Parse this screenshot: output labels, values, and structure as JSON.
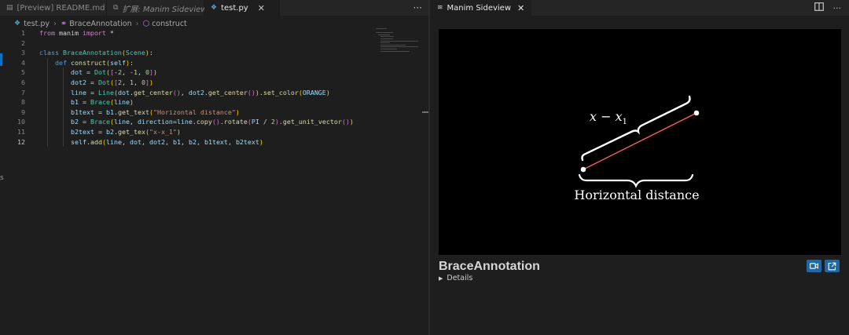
{
  "left_tabs": [
    {
      "icon": "preview-icon",
      "label": "[Preview] README.md",
      "active": false,
      "italic": false
    },
    {
      "icon": "extension-icon",
      "label": "扩展: Manim Sideview",
      "active": false,
      "italic": true
    },
    {
      "icon": "python-file-icon",
      "label": "test.py",
      "active": true,
      "italic": false
    }
  ],
  "tab_actions_glyph": "···",
  "breadcrumb": {
    "file": "test.py",
    "symbol1": "BraceAnnotation",
    "symbol2": "construct"
  },
  "code_lines": [
    {
      "n": "1",
      "indent": 0,
      "tokens": [
        [
          "kw",
          "from"
        ],
        [
          "p",
          " manim "
        ],
        [
          "kw",
          "import"
        ],
        [
          "p",
          " *"
        ]
      ]
    },
    {
      "n": "2",
      "indent": 0,
      "tokens": []
    },
    {
      "n": "3",
      "indent": 0,
      "tokens": [
        [
          "kb",
          "class"
        ],
        [
          "p",
          " "
        ],
        [
          "cls",
          "BraceAnnotation"
        ],
        [
          "brk1",
          "("
        ],
        [
          "cls",
          "Scene"
        ],
        [
          "brk1",
          ")"
        ],
        [
          "p",
          ":"
        ]
      ]
    },
    {
      "n": "4",
      "indent": 1,
      "tokens": [
        [
          "kb",
          "def"
        ],
        [
          "p",
          " "
        ],
        [
          "fn",
          "construct"
        ],
        [
          "brk1",
          "("
        ],
        [
          "var",
          "self"
        ],
        [
          "brk1",
          ")"
        ],
        [
          "p",
          ":"
        ]
      ]
    },
    {
      "n": "5",
      "indent": 2,
      "tokens": [
        [
          "var",
          "dot"
        ],
        [
          "p",
          " = "
        ],
        [
          "cls",
          "Dot"
        ],
        [
          "brk1",
          "("
        ],
        [
          "brk2",
          "["
        ],
        [
          "p",
          "-"
        ],
        [
          "num",
          "2"
        ],
        [
          "p",
          ", -"
        ],
        [
          "num",
          "1"
        ],
        [
          "p",
          ", "
        ],
        [
          "num",
          "0"
        ],
        [
          "brk2",
          "]"
        ],
        [
          "brk1",
          ")"
        ]
      ]
    },
    {
      "n": "6",
      "indent": 2,
      "tokens": [
        [
          "var",
          "dot2"
        ],
        [
          "p",
          " = "
        ],
        [
          "cls",
          "Dot"
        ],
        [
          "brk1",
          "("
        ],
        [
          "brk2",
          "["
        ],
        [
          "num",
          "2"
        ],
        [
          "p",
          ", "
        ],
        [
          "num",
          "1"
        ],
        [
          "p",
          ", "
        ],
        [
          "num",
          "0"
        ],
        [
          "brk2",
          "]"
        ],
        [
          "brk1",
          ")"
        ]
      ]
    },
    {
      "n": "7",
      "indent": 2,
      "tokens": [
        [
          "var",
          "line"
        ],
        [
          "p",
          " = "
        ],
        [
          "cls",
          "Line"
        ],
        [
          "brk1",
          "("
        ],
        [
          "var",
          "dot"
        ],
        [
          "p",
          "."
        ],
        [
          "fn",
          "get_center"
        ],
        [
          "brk2",
          "()"
        ],
        [
          "p",
          ", "
        ],
        [
          "var",
          "dot2"
        ],
        [
          "p",
          "."
        ],
        [
          "fn",
          "get_center"
        ],
        [
          "brk2",
          "()"
        ],
        [
          "brk1",
          ")"
        ],
        [
          "p",
          "."
        ],
        [
          "fn",
          "set_color"
        ],
        [
          "brk1",
          "("
        ],
        [
          "var",
          "ORANGE"
        ],
        [
          "brk1",
          ")"
        ]
      ]
    },
    {
      "n": "8",
      "indent": 2,
      "tokens": [
        [
          "var",
          "b1"
        ],
        [
          "p",
          " = "
        ],
        [
          "cls",
          "Brace"
        ],
        [
          "brk1",
          "("
        ],
        [
          "var",
          "line"
        ],
        [
          "brk1",
          ")"
        ]
      ]
    },
    {
      "n": "9",
      "indent": 2,
      "tokens": [
        [
          "var",
          "b1text"
        ],
        [
          "p",
          " = "
        ],
        [
          "var",
          "b1"
        ],
        [
          "p",
          "."
        ],
        [
          "fn",
          "get_text"
        ],
        [
          "brk1",
          "("
        ],
        [
          "str",
          "\"Horizontal distance\""
        ],
        [
          "brk1",
          ")"
        ]
      ]
    },
    {
      "n": "10",
      "indent": 2,
      "tokens": [
        [
          "var",
          "b2"
        ],
        [
          "p",
          " = "
        ],
        [
          "cls",
          "Brace"
        ],
        [
          "brk1",
          "("
        ],
        [
          "var",
          "line"
        ],
        [
          "p",
          ", "
        ],
        [
          "var",
          "direction"
        ],
        [
          "p",
          "="
        ],
        [
          "var",
          "line"
        ],
        [
          "p",
          "."
        ],
        [
          "fn",
          "copy"
        ],
        [
          "brk2",
          "()"
        ],
        [
          "p",
          "."
        ],
        [
          "fn",
          "rotate"
        ],
        [
          "brk2",
          "("
        ],
        [
          "var",
          "PI"
        ],
        [
          "p",
          " / "
        ],
        [
          "num",
          "2"
        ],
        [
          "brk2",
          ")"
        ],
        [
          "p",
          "."
        ],
        [
          "fn",
          "get_unit_vector"
        ],
        [
          "brk2",
          "()"
        ],
        [
          "brk1",
          ")"
        ]
      ]
    },
    {
      "n": "11",
      "indent": 2,
      "tokens": [
        [
          "var",
          "b2text"
        ],
        [
          "p",
          " = "
        ],
        [
          "var",
          "b2"
        ],
        [
          "p",
          "."
        ],
        [
          "fn",
          "get_tex"
        ],
        [
          "brk1",
          "("
        ],
        [
          "str",
          "\"x-x_1\""
        ],
        [
          "brk1",
          ")"
        ]
      ]
    },
    {
      "n": "12",
      "indent": 2,
      "tokens": [
        [
          "var",
          "self"
        ],
        [
          "p",
          "."
        ],
        [
          "fn",
          "add"
        ],
        [
          "brk1",
          "("
        ],
        [
          "var",
          "line"
        ],
        [
          "p",
          ", "
        ],
        [
          "var",
          "dot"
        ],
        [
          "p",
          ", "
        ],
        [
          "var",
          "dot2"
        ],
        [
          "p",
          ", "
        ],
        [
          "var",
          "b1"
        ],
        [
          "p",
          ", "
        ],
        [
          "var",
          "b2"
        ],
        [
          "p",
          ", "
        ],
        [
          "var",
          "b1text"
        ],
        [
          "p",
          ", "
        ],
        [
          "var",
          "b2text"
        ],
        [
          "brk1",
          ")"
        ]
      ]
    }
  ],
  "current_line": "12",
  "right_tab": {
    "icon": "manim-icon",
    "label": "Manim Sideview"
  },
  "right_actions": [
    "split-editor-icon",
    "more-icon"
  ],
  "scene": {
    "title": "BraceAnnotation",
    "details": "Details",
    "bottom_label": "Horizontal distance",
    "top_label_main": "x − x",
    "top_label_sub": "1"
  },
  "colors": {
    "line": "#fc6255",
    "accent": "#1f68a8",
    "dot": "#ffffff"
  },
  "edge_glyph": "s"
}
